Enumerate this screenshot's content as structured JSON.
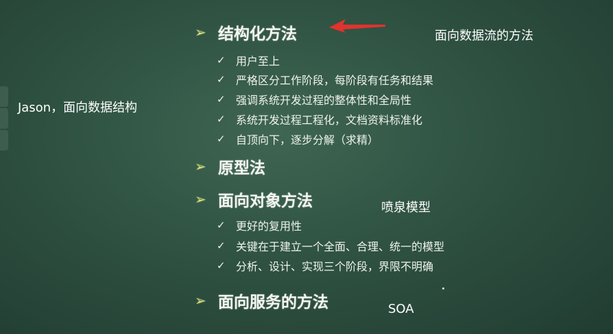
{
  "sections": [
    {
      "title": "结构化方法",
      "items": [
        "用户至上",
        "严格区分工作阶段，每阶段有任务和结果",
        "强调系统开发过程的整体性和全局性",
        "系统开发过程工程化，文档资料标准化",
        "自顶向下，逐步分解（求精）"
      ]
    },
    {
      "title": "原型法",
      "items": []
    },
    {
      "title": "面向对象方法",
      "items": [
        "更好的复用性",
        "关键在于建立一个全面、合理、统一的模型",
        "分析、设计、实现三个阶段，界限不明确"
      ]
    },
    {
      "title": "面向服务的方法",
      "items": []
    }
  ],
  "annotations": {
    "structured": "面向数据流的方法",
    "jason": "Jason，面向数据结构",
    "fountain": "喷泉模型",
    "soa": "SOA"
  },
  "icons": {
    "bullet": "arrow-bullet-icon",
    "check": "check-icon",
    "pointer": "red-arrow-icon"
  },
  "colors": {
    "board": "#2f5242",
    "bullet": "#d8e06a",
    "pointer": "#e2332c"
  }
}
